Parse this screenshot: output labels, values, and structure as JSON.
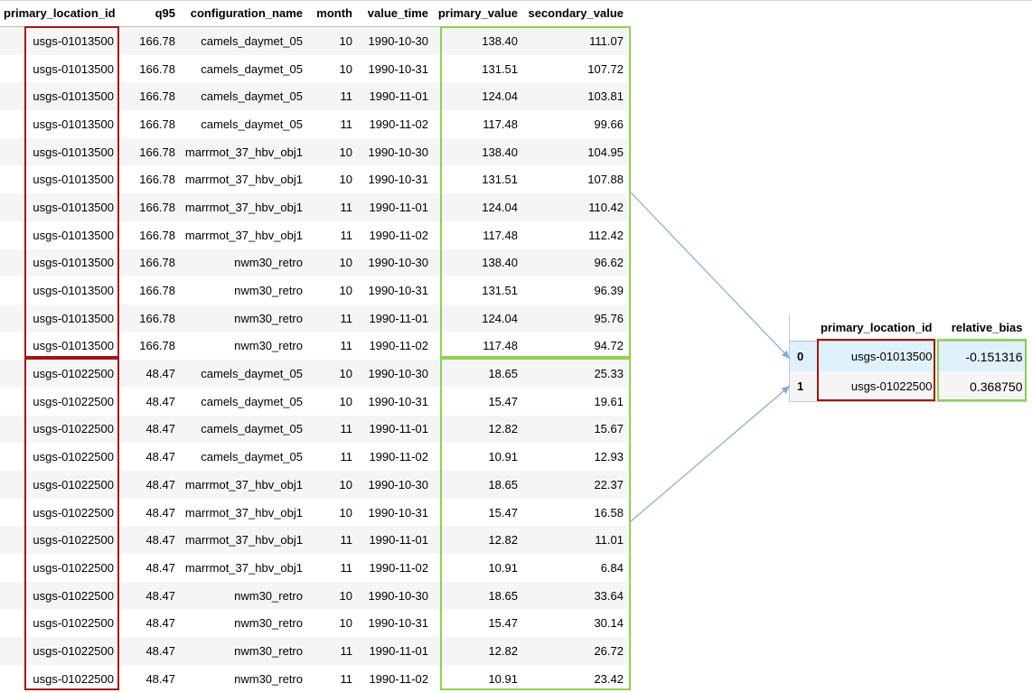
{
  "colors": {
    "red_box": "#a31515",
    "green_box": "#8fd14f",
    "arrow": "#8aa9d6",
    "stripe": "#f5f5f5",
    "highlight_row": "#dff1fb"
  },
  "main_table": {
    "columns": [
      "primary_location_id",
      "q95",
      "configuration_name",
      "month",
      "value_time",
      "primary_value",
      "secondary_value"
    ],
    "rows": [
      [
        "usgs-01013500",
        "166.78",
        "camels_daymet_05",
        "10",
        "1990-10-30",
        "138.40",
        "111.07"
      ],
      [
        "usgs-01013500",
        "166.78",
        "camels_daymet_05",
        "10",
        "1990-10-31",
        "131.51",
        "107.72"
      ],
      [
        "usgs-01013500",
        "166.78",
        "camels_daymet_05",
        "11",
        "1990-11-01",
        "124.04",
        "103.81"
      ],
      [
        "usgs-01013500",
        "166.78",
        "camels_daymet_05",
        "11",
        "1990-11-02",
        "117.48",
        "99.66"
      ],
      [
        "usgs-01013500",
        "166.78",
        "marrmot_37_hbv_obj1",
        "10",
        "1990-10-30",
        "138.40",
        "104.95"
      ],
      [
        "usgs-01013500",
        "166.78",
        "marrmot_37_hbv_obj1",
        "10",
        "1990-10-31",
        "131.51",
        "107.88"
      ],
      [
        "usgs-01013500",
        "166.78",
        "marrmot_37_hbv_obj1",
        "11",
        "1990-11-01",
        "124.04",
        "110.42"
      ],
      [
        "usgs-01013500",
        "166.78",
        "marrmot_37_hbv_obj1",
        "11",
        "1990-11-02",
        "117.48",
        "112.42"
      ],
      [
        "usgs-01013500",
        "166.78",
        "nwm30_retro",
        "10",
        "1990-10-30",
        "138.40",
        "96.62"
      ],
      [
        "usgs-01013500",
        "166.78",
        "nwm30_retro",
        "10",
        "1990-10-31",
        "131.51",
        "96.39"
      ],
      [
        "usgs-01013500",
        "166.78",
        "nwm30_retro",
        "11",
        "1990-11-01",
        "124.04",
        "95.76"
      ],
      [
        "usgs-01013500",
        "166.78",
        "nwm30_retro",
        "11",
        "1990-11-02",
        "117.48",
        "94.72"
      ],
      [
        "usgs-01022500",
        "48.47",
        "camels_daymet_05",
        "10",
        "1990-10-30",
        "18.65",
        "25.33"
      ],
      [
        "usgs-01022500",
        "48.47",
        "camels_daymet_05",
        "10",
        "1990-10-31",
        "15.47",
        "19.61"
      ],
      [
        "usgs-01022500",
        "48.47",
        "camels_daymet_05",
        "11",
        "1990-11-01",
        "12.82",
        "15.67"
      ],
      [
        "usgs-01022500",
        "48.47",
        "camels_daymet_05",
        "11",
        "1990-11-02",
        "10.91",
        "12.93"
      ],
      [
        "usgs-01022500",
        "48.47",
        "marrmot_37_hbv_obj1",
        "10",
        "1990-10-30",
        "18.65",
        "22.37"
      ],
      [
        "usgs-01022500",
        "48.47",
        "marrmot_37_hbv_obj1",
        "10",
        "1990-10-31",
        "15.47",
        "16.58"
      ],
      [
        "usgs-01022500",
        "48.47",
        "marrmot_37_hbv_obj1",
        "11",
        "1990-11-01",
        "12.82",
        "11.01"
      ],
      [
        "usgs-01022500",
        "48.47",
        "marrmot_37_hbv_obj1",
        "11",
        "1990-11-02",
        "10.91",
        "6.84"
      ],
      [
        "usgs-01022500",
        "48.47",
        "nwm30_retro",
        "10",
        "1990-10-30",
        "18.65",
        "33.64"
      ],
      [
        "usgs-01022500",
        "48.47",
        "nwm30_retro",
        "10",
        "1990-10-31",
        "15.47",
        "30.14"
      ],
      [
        "usgs-01022500",
        "48.47",
        "nwm30_retro",
        "11",
        "1990-11-01",
        "12.82",
        "26.72"
      ],
      [
        "usgs-01022500",
        "48.47",
        "nwm30_retro",
        "11",
        "1990-11-02",
        "10.91",
        "23.42"
      ]
    ]
  },
  "result_table": {
    "columns": [
      "",
      "primary_location_id",
      "relative_bias"
    ],
    "rows": [
      {
        "index": "0",
        "primary_location_id": "usgs-01013500",
        "relative_bias": "-0.151316"
      },
      {
        "index": "1",
        "primary_location_id": "usgs-01022500",
        "relative_bias": "0.368750"
      }
    ]
  }
}
